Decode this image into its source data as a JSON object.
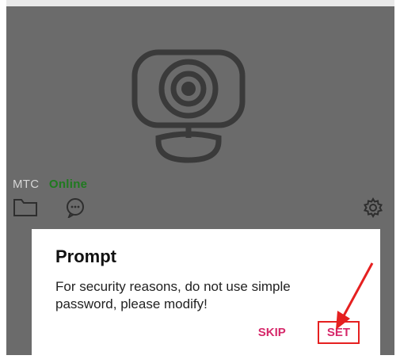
{
  "device": {
    "name": "MTC",
    "status": "Online",
    "status_color": "#1f7a1f"
  },
  "icons": {
    "camera": "camera-icon",
    "folder": "folder-icon",
    "chat": "chat-icon",
    "settings": "settings-icon",
    "annotation": "red-arrow-icon"
  },
  "dialog": {
    "title": "Prompt",
    "message": "For security reasons, do not use simple password, please modify!",
    "skip_label": "SKIP",
    "set_label": "SET",
    "accent_color": "#d6286a"
  },
  "colors": {
    "overlay": "#6b6b6b",
    "annotation_red": "#e52020"
  }
}
